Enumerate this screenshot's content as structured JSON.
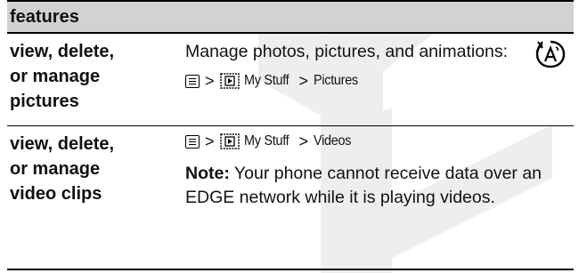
{
  "header": {
    "title": "features"
  },
  "rows": [
    {
      "feature_lines": [
        "view, delete,",
        "or manage",
        "pictures"
      ],
      "description": "Manage photos, pictures, and animations:",
      "path": {
        "menu_icon": "menu-key-icon",
        "separator": ">",
        "item_icon": "my-stuff-icon",
        "item": "My Stuff",
        "target": "Pictures"
      },
      "badge_icon": "network-dependent-feature-icon"
    },
    {
      "feature_lines": [
        "view, delete,",
        "or manage",
        "video clips"
      ],
      "path": {
        "menu_icon": "menu-key-icon",
        "separator": ">",
        "item_icon": "my-stuff-icon",
        "item": "My Stuff",
        "target": "Videos"
      },
      "note_label": "Note:",
      "note_text": "Your phone cannot receive data over an EDGE network while it is playing videos."
    }
  ]
}
